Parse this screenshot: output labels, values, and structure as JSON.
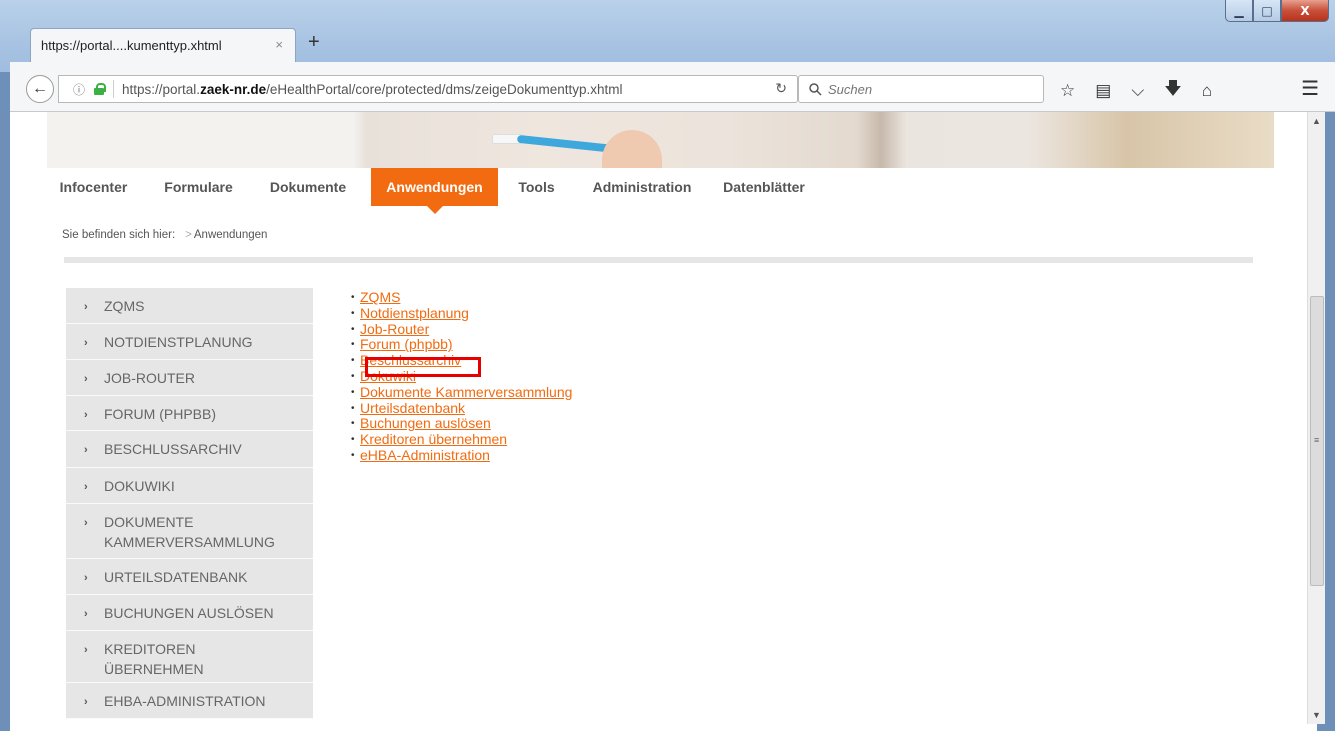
{
  "browser": {
    "tab_title": "https://portal....kumenttyp.xhtml",
    "tab_close": "×",
    "new_tab": "+",
    "url_prefix": "https://portal.",
    "url_domain": "zaek-nr.de",
    "url_path": "/eHealthPortal/core/protected/dms/zeigeDokumenttyp.xhtml",
    "search_placeholder": "Suchen",
    "window_controls": {
      "minimize": "▁",
      "maximize": "□",
      "close": "X"
    },
    "icons": [
      "bookmark-star-icon",
      "reading-list-icon",
      "pocket-icon",
      "download-icon",
      "home-icon",
      "menu-icon"
    ]
  },
  "nav": {
    "items": [
      "Infocenter",
      "Formulare",
      "Dokumente",
      "Anwendungen",
      "Tools",
      "Administration",
      "Datenblätter"
    ],
    "active": "Anwendungen"
  },
  "breadcrumb": {
    "label": "Sie befinden sich hier:",
    "sep": ">",
    "current": "Anwendungen"
  },
  "sidebar": {
    "items": [
      "ZQMS",
      "NOTDIENSTPLANUNG",
      "JOB-ROUTER",
      "FORUM (PHPBB)",
      "BESCHLUSSARCHIV",
      "DOKUWIKI",
      "DOKUMENTE KAMMERVERSAMMLUNG",
      "URTEILSDATENBANK",
      "BUCHUNGEN AUSLÖSEN",
      "KREDITOREN ÜBERNEHMEN",
      "EHBA-ADMINISTRATION"
    ]
  },
  "links": {
    "items": [
      "ZQMS",
      "Notdienstplanung",
      "Job-Router",
      "Forum (phpbb)",
      "Beschlussarchiv",
      "Dokuwiki",
      "Dokumente Kammerversammlung",
      "Urteilsdatenbank",
      "Buchungen auslösen",
      "Kreditoren übernehmen",
      "eHBA-Administration"
    ],
    "highlighted": "Forum (phpbb)"
  },
  "colors": {
    "accent": "#f26b10",
    "highlight_box": "#e60000",
    "sidebar_bg": "#e6e6e6"
  }
}
